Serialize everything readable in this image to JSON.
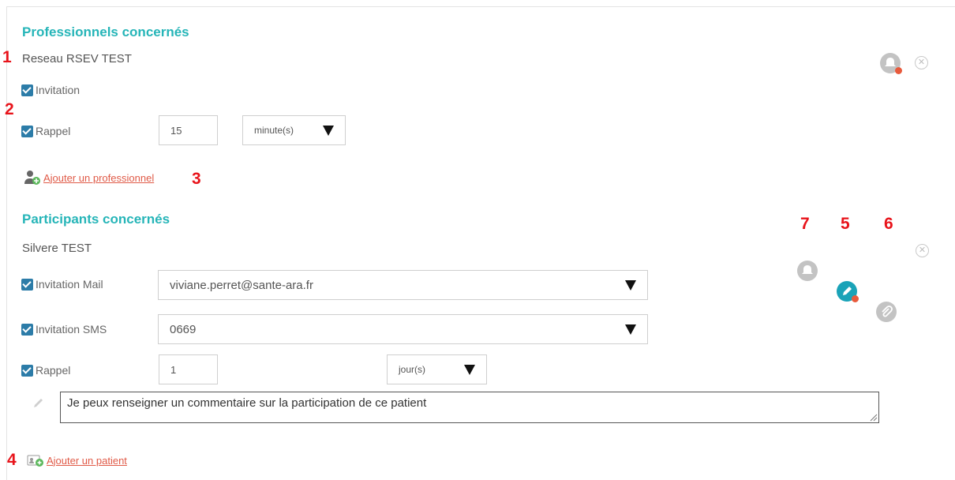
{
  "professionals": {
    "title": "Professionnels concernés",
    "name": "Reseau RSEV TEST",
    "invitation_label": "Invitation",
    "rappel_label": "Rappel",
    "rappel_value": "15",
    "rappel_unit": "minute(s)",
    "add_link": "Ajouter un professionnel"
  },
  "participants": {
    "title": "Participants concernés",
    "name": "Silvere TEST",
    "mail_label": "Invitation Mail",
    "mail_value": "viviane.perret@sante-ara.fr",
    "sms_label": "Invitation SMS",
    "sms_value": "0669",
    "rappel_label": "Rappel",
    "rappel_value": "1",
    "rappel_unit": "jour(s)",
    "comment": "Je peux renseigner un commentaire sur la participation de ce patient",
    "add_link": "Ajouter un patient"
  },
  "markers": {
    "m1": "1",
    "m2": "2",
    "m3": "3",
    "m4": "4",
    "m5": "5",
    "m6": "6",
    "m7": "7"
  },
  "colors": {
    "accent": "#26b5b8",
    "checkbox": "#2c7ca8",
    "link": "#e05a47",
    "marker": "#e8141b",
    "status_dot": "#e85a3c"
  },
  "icons": {
    "bell": "bell-icon",
    "edit": "pencil-icon",
    "attach": "paperclip-icon",
    "close": "close-icon",
    "add_user": "add-user-icon",
    "add_patient": "add-patient-icon",
    "comment": "pencil-icon"
  }
}
